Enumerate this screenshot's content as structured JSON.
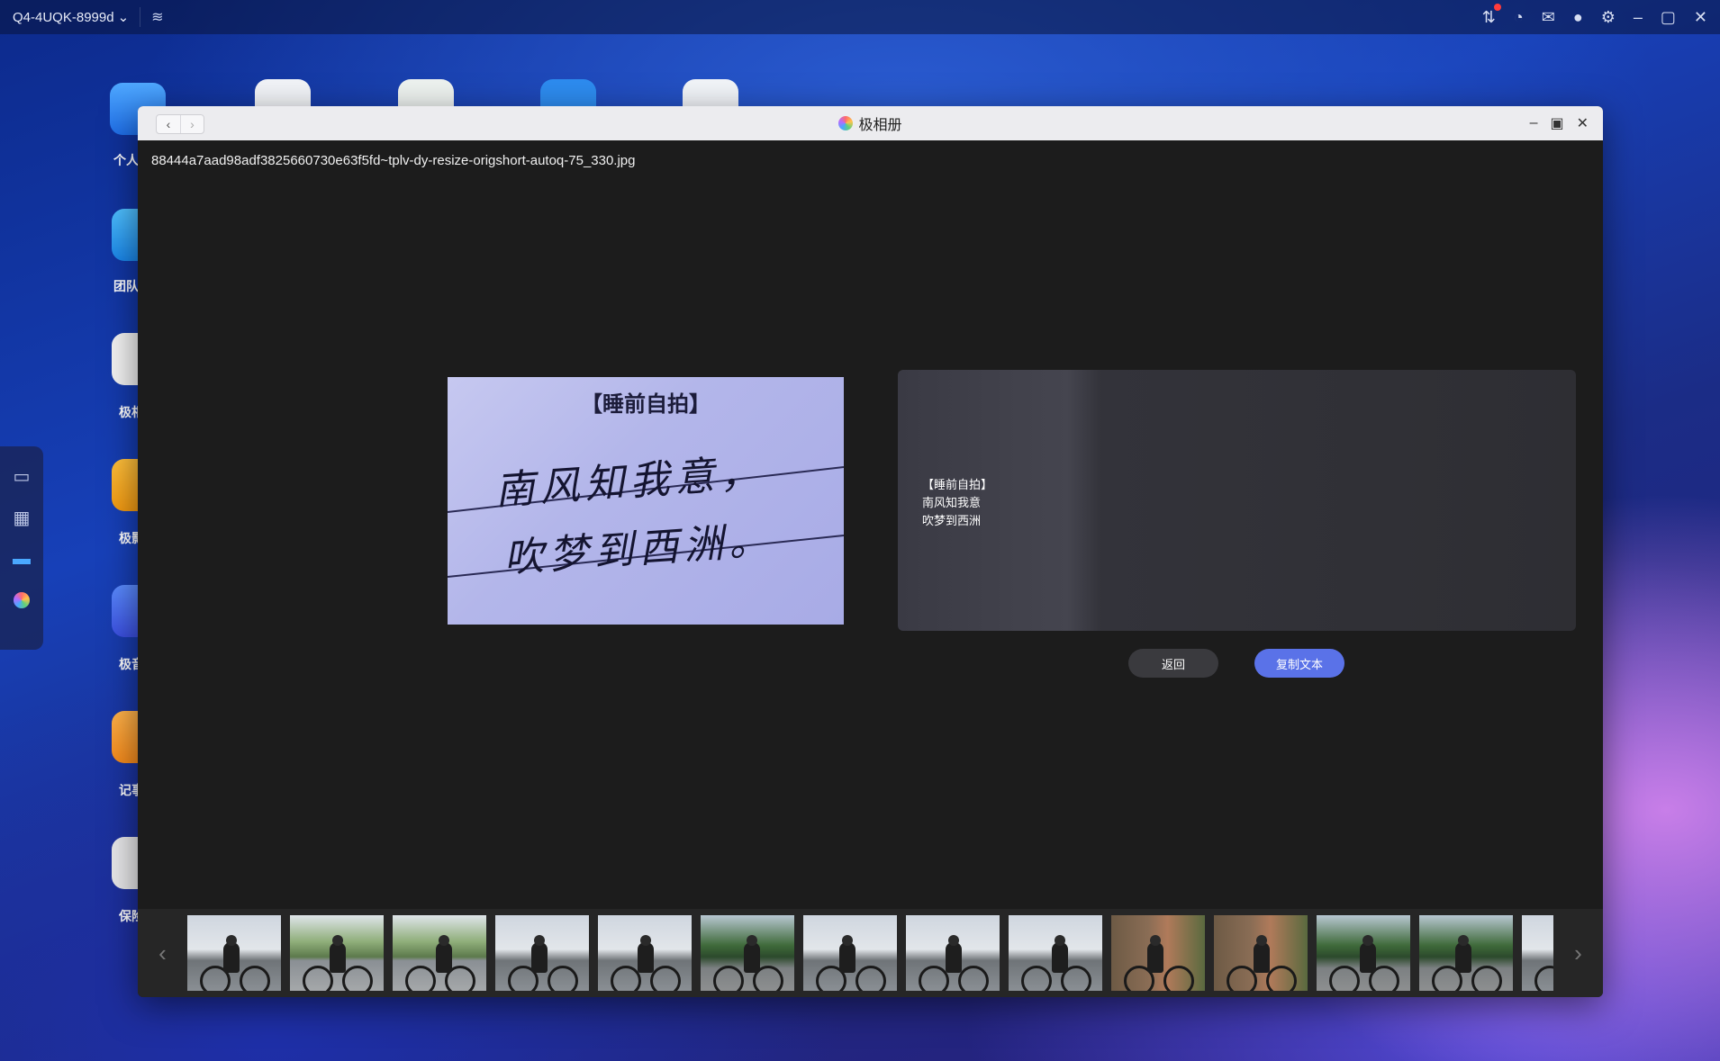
{
  "system_bar": {
    "device_name": "Q4-4UQK-8999d",
    "device_chevron": "⌄",
    "wifi_glyph": "≋",
    "icons": [
      {
        "name": "transfer-icon",
        "glyph": "⇅"
      },
      {
        "name": "speed-icon",
        "glyph": "◔"
      },
      {
        "name": "mail-icon",
        "glyph": "✉"
      },
      {
        "name": "user-icon",
        "glyph": "●"
      },
      {
        "name": "gear-icon",
        "glyph": "⚙"
      },
      {
        "name": "minimize-icon",
        "glyph": "–"
      },
      {
        "name": "maximize-icon",
        "glyph": "▢"
      },
      {
        "name": "close-icon",
        "glyph": "✕"
      }
    ]
  },
  "desktop": {
    "labels": [
      "个人",
      "团队",
      "极相",
      "极影",
      "极音",
      "记事",
      "保险"
    ]
  },
  "window": {
    "title": "极相册",
    "nav_back": "‹",
    "nav_forward": "›",
    "ctrl_minimize": "–",
    "ctrl_maximize": "▣",
    "ctrl_close": "✕",
    "filename": "88444a7aad98adf3825660730e63f5fd~tplv-dy-resize-origshort-autoq-75_330.jpg"
  },
  "photo": {
    "heading": "【睡前自拍】",
    "line1": "南风知我意，",
    "line2": "吹梦到西洲。"
  },
  "ocr": {
    "lines": [
      "【睡前自拍】",
      "南风知我意",
      "吹梦到西洲"
    ]
  },
  "buttons": {
    "back": "返回",
    "copy": "复制文本"
  },
  "filmstrip": {
    "prev": "‹",
    "next": "›",
    "thumbs": [
      "road",
      "green",
      "green",
      "road",
      "road",
      "tree",
      "road",
      "road",
      "road",
      "brick",
      "brick",
      "tree",
      "tree",
      "road"
    ]
  }
}
